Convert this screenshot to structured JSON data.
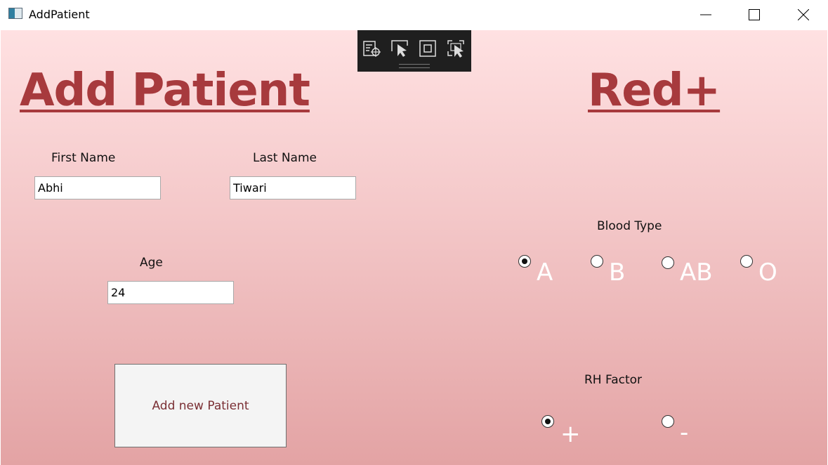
{
  "window": {
    "title": "AddPatient"
  },
  "icons": {
    "app": "app-window-icon",
    "minimize": "minimize-icon",
    "maximize": "maximize-icon",
    "close": "close-icon",
    "devtools": [
      "live-visual-tree-icon",
      "select-element-icon",
      "display-layout-adorners-icon",
      "track-focused-element-icon"
    ]
  },
  "header": {
    "title": "Add Patient",
    "brand": "Red+"
  },
  "form": {
    "first_name": {
      "label": "First Name",
      "value": "Abhi"
    },
    "last_name": {
      "label": "Last Name",
      "value": "Tiwari"
    },
    "age": {
      "label": "Age",
      "value": "24"
    },
    "submit_label": "Add new Patient"
  },
  "blood_type": {
    "label": "Blood Type",
    "options": [
      "A",
      "B",
      "AB",
      "O"
    ],
    "selected": "A"
  },
  "rh_factor": {
    "label": "RH Factor",
    "options": [
      "+",
      "-"
    ],
    "selected": "+"
  },
  "colors": {
    "accent": "#a73a3d",
    "gradient_top": "#ffe1e2",
    "gradient_bottom": "#e3a3a4",
    "button_text": "#7a2f34"
  }
}
